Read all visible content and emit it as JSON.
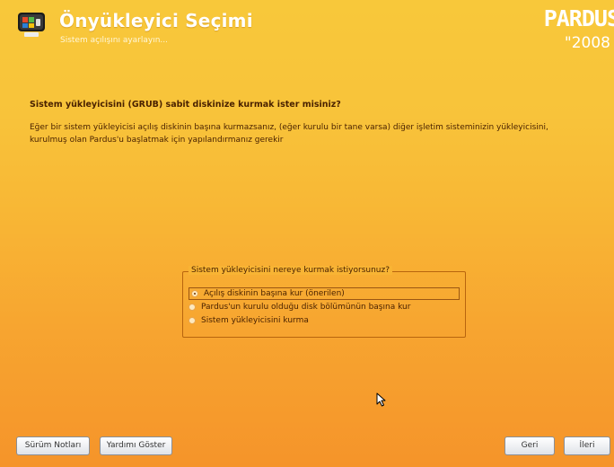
{
  "header": {
    "title": "Önyükleyici Seçimi",
    "subtitle": "Sistem açılışını ayarlayın...",
    "brand_name": "PARDUS",
    "brand_year": "\"2008",
    "icon": "bootloader-screen-icon"
  },
  "main": {
    "question": "Sistem yükleyicisini (GRUB) sabit diskinize kurmak ister misiniz?",
    "description": "Eğer bir sistem yükleyicisi açılış diskinin başına kurmazsanız, (eğer kurulu bir tane varsa) diğer işletim sisteminizin yükleyicisini, kurulmuş olan Pardus'u başlatmak için yapılandırmanız gerekir"
  },
  "options": {
    "legend": "Sistem yükleyicisini nereye kurmak istiyorsunuz?",
    "items": [
      {
        "label": "Açılış diskinin başına kur (önerilen)",
        "selected": true
      },
      {
        "label": "Pardus'un kurulu olduğu disk bölümünün başına kur",
        "selected": false
      },
      {
        "label": "Sistem yükleyicisini kurma",
        "selected": false
      }
    ]
  },
  "footer": {
    "release_notes_label": "Sürüm Notları",
    "help_label": "Yardımı Göster",
    "back_label": "Geri",
    "next_label": "İleri"
  },
  "colors": {
    "background_top": "#f8c83a",
    "background_bottom": "#f5942a",
    "text": "#4a2200",
    "frame_border": "#b8650e"
  }
}
